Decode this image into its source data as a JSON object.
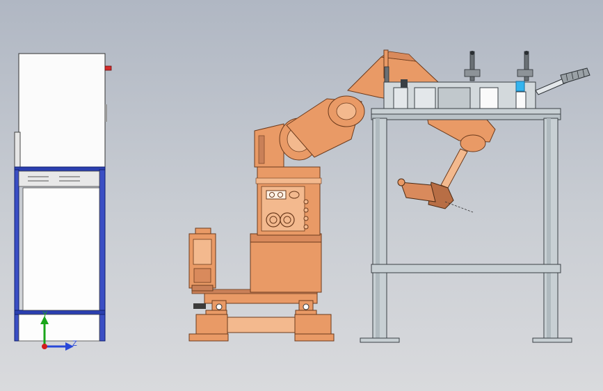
{
  "viewport": {
    "name": "3D CAD viewport",
    "background_top": "#b0b7c3",
    "background_bottom": "#d9dadd"
  },
  "colors": {
    "robot_orange": "#e99a66",
    "robot_orange_dark": "#b86e45",
    "robot_orange_light": "#f3b98e",
    "frame_gray": "#c8d0d4",
    "frame_edge": "#3a4045",
    "cabinet_white": "#fbfbfb",
    "cabinet_blue_frame": "#2b3fb0",
    "accent_cyan": "#34b4ee",
    "indicator_red": "#d22a2a"
  },
  "triad": {
    "y_label": "Y",
    "z_label": "Z",
    "y_color": "#1aa51a",
    "z_color": "#2848d8",
    "x_color": "#d21c1c"
  },
  "objects": [
    "control-cabinet",
    "industrial-robot",
    "fixture-table",
    "clamp-row"
  ]
}
